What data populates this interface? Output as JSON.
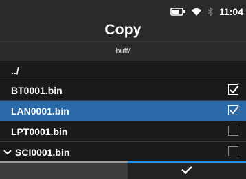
{
  "status": {
    "battery_icon": "battery-icon",
    "wifi_icon": "wifi-icon",
    "bluetooth_icon": "bluetooth-icon",
    "time": "11:04"
  },
  "title": "Copy",
  "path": "buff/",
  "files": [
    {
      "label": "../",
      "type": "parent"
    },
    {
      "label": "BT0001.bin",
      "checked": true,
      "selected": false
    },
    {
      "label": "LAN0001.bin",
      "checked": true,
      "selected": true
    },
    {
      "label": "LPT0001.bin",
      "checked": false,
      "selected": false
    },
    {
      "label": "SCI0001.bin",
      "checked": false,
      "selected": false,
      "scroll_indicator": "chevron-down-icon"
    }
  ],
  "buttons": {
    "back_icon": "back-icon",
    "confirm_icon": "checkmark-icon"
  },
  "colors": {
    "selected_row": "#2a6aa8",
    "confirm_accent": "#2a8fe0"
  }
}
